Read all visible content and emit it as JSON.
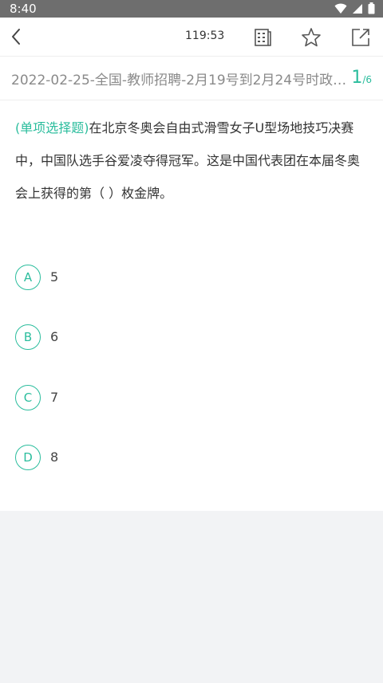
{
  "status": {
    "time": "8:40"
  },
  "toolbar": {
    "timer": "119:53"
  },
  "exam": {
    "title": "2022-02-25-全国-教师招聘-2月19号到2月24号时政…",
    "current": "1",
    "total": "/6"
  },
  "question": {
    "type": "(单项选择题)",
    "text": "在北京冬奥会自由式滑雪女子U型场地技巧决赛中，中国队选手谷爱凌夺得冠军。这是中国代表团在本届冬奥会上获得的第（ ）枚金牌。"
  },
  "options": [
    {
      "letter": "A",
      "text": "5"
    },
    {
      "letter": "B",
      "text": "6"
    },
    {
      "letter": "C",
      "text": "7"
    },
    {
      "letter": "D",
      "text": "8"
    }
  ],
  "colors": {
    "accent": "#2bbd9d",
    "status_bar": "#6e6e6e",
    "footer_bg": "#f2f3f5"
  },
  "icons": [
    "wifi-icon",
    "signal-icon",
    "battery-icon",
    "back-arrow-icon",
    "answer-sheet-icon",
    "star-icon",
    "share-icon"
  ]
}
